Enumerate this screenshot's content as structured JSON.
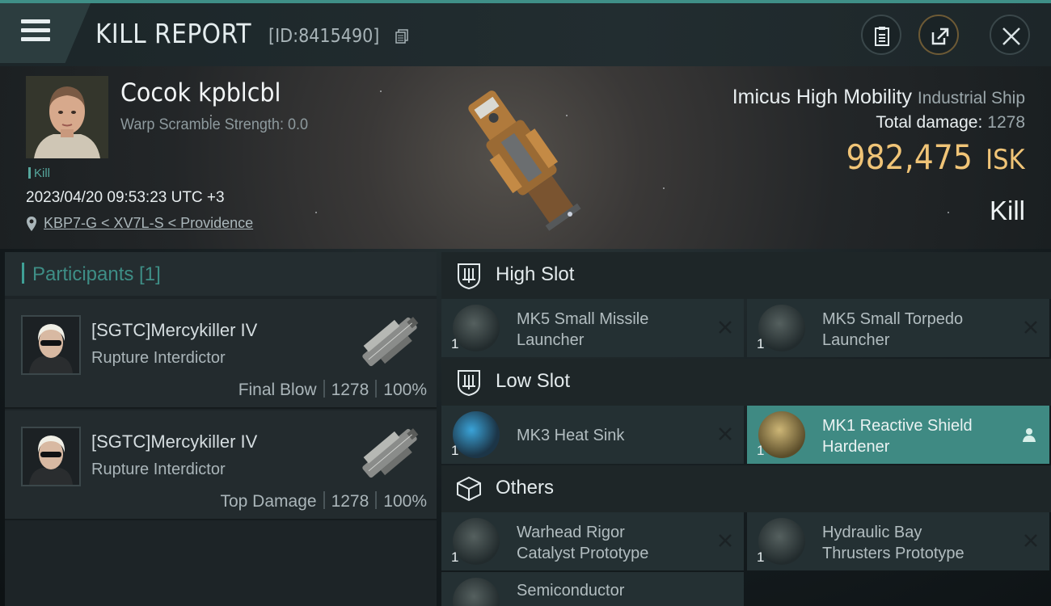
{
  "header": {
    "title": "KILL REPORT",
    "report_id": "[ID:8415490]"
  },
  "victim": {
    "name": "Cocok kpblcbl",
    "warp_scramble": "Warp Scramble Strength: 0.0",
    "tag": "Kill",
    "datetime": "2023/04/20 09:53:23 UTC +3",
    "location": "KBP7-G < XV7L-S < Providence"
  },
  "ship": {
    "name": "Imicus High Mobility",
    "class": "Industrial Ship",
    "total_damage_label": "Total damage:",
    "total_damage": "1278",
    "isk_value": "982,475",
    "isk_unit": "ISK",
    "kill_type": "Kill"
  },
  "participants": {
    "title": "Participants [1]",
    "items": [
      {
        "name": "[SGTC]Mercykiller IV",
        "ship": "Rupture Interdictor",
        "role": "Final Blow",
        "damage": "1278",
        "percent": "100%"
      },
      {
        "name": "[SGTC]Mercykiller IV",
        "ship": "Rupture Interdictor",
        "role": "Top Damage",
        "damage": "1278",
        "percent": "100%"
      }
    ]
  },
  "slots": {
    "high": {
      "title": "High Slot",
      "modules": [
        {
          "name_line1": "MK5 Small Missile",
          "name_line2": "Launcher",
          "qty": "1"
        },
        {
          "name_line1": "MK5 Small Torpedo",
          "name_line2": "Launcher",
          "qty": "1"
        }
      ]
    },
    "low": {
      "title": "Low Slot",
      "modules": [
        {
          "name_line1": "MK3 Heat Sink",
          "name_line2": "",
          "qty": "1"
        },
        {
          "name_line1": "MK1 Reactive Shield",
          "name_line2": "Hardener",
          "qty": "1"
        }
      ]
    },
    "others": {
      "title": "Others",
      "modules": [
        {
          "name_line1": "Warhead Rigor",
          "name_line2": "Catalyst Prototype",
          "qty": "1"
        },
        {
          "name_line1": "Hydraulic Bay",
          "name_line2": "Thrusters Prototype",
          "qty": "1"
        },
        {
          "name_line1": "Semiconductor",
          "name_line2": "",
          "qty": ""
        }
      ]
    }
  },
  "colors": {
    "accent": "#3f8a83",
    "isk": "#f0c477",
    "participants_title": "#3e8e86"
  }
}
